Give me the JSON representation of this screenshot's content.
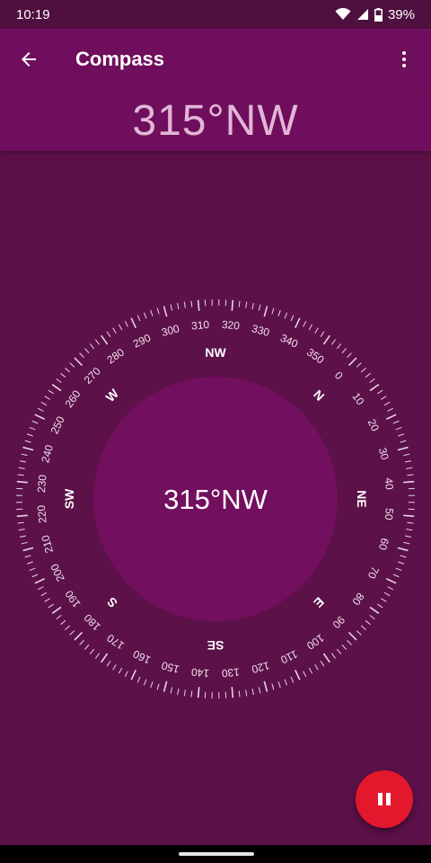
{
  "status_bar": {
    "time": "10:19",
    "battery": "39%"
  },
  "app_bar": {
    "title": "Compass"
  },
  "heading": {
    "display": "315°NW"
  },
  "compass": {
    "center_text": "315°NW",
    "heading_deg": 315,
    "directions": [
      {
        "label": "N",
        "bearing": 0
      },
      {
        "label": "NE",
        "bearing": 45
      },
      {
        "label": "E",
        "bearing": 90
      },
      {
        "label": "SE",
        "bearing": 135
      },
      {
        "label": "S",
        "bearing": 180
      },
      {
        "label": "SW",
        "bearing": 225
      },
      {
        "label": "W",
        "bearing": 270
      },
      {
        "label": "NW",
        "bearing": 315
      }
    ],
    "degree_labels": [
      0,
      10,
      20,
      30,
      40,
      50,
      60,
      70,
      80,
      90,
      100,
      110,
      120,
      130,
      140,
      150,
      160,
      170,
      180,
      190,
      200,
      210,
      220,
      230,
      240,
      250,
      260,
      270,
      280,
      290,
      300,
      310,
      320,
      330,
      340,
      350
    ]
  },
  "colors": {
    "background": "#5c1149",
    "app_bar": "#6f0e5c",
    "inner_disc": "#730f5f",
    "fab": "#e3182d"
  },
  "icons": {
    "back": "arrow-back-icon",
    "menu": "more-vert-icon",
    "fab": "pause-icon"
  }
}
